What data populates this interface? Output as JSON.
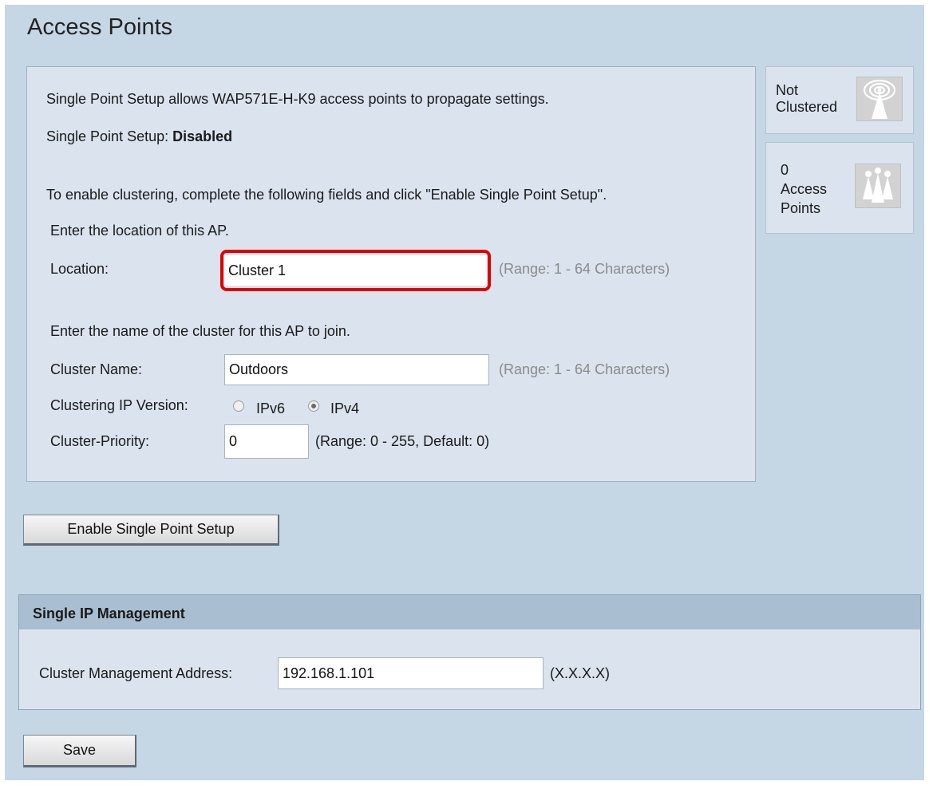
{
  "page": {
    "title": "Access Points"
  },
  "main": {
    "intro": "Single Point Setup allows WAP571E-H-K9 access points to propagate settings.",
    "status_label": "Single Point Setup: ",
    "status_value": "Disabled",
    "instructions": "To enable clustering, complete the following fields and click \"Enable Single Point Setup\".",
    "location_prompt": "Enter the location of this AP.",
    "location": {
      "label": "Location:",
      "value": "Cluster 1",
      "hint": "(Range: 1 - 64 Characters)"
    },
    "cluster_prompt": "Enter the name of the cluster for this AP to join.",
    "cluster_name": {
      "label": "Cluster Name:",
      "value": "Outdoors",
      "hint": "(Range: 1 - 64 Characters)"
    },
    "ip_version": {
      "label": "Clustering IP Version:",
      "options": [
        "IPv6",
        "IPv4"
      ],
      "selected": "IPv4"
    },
    "priority": {
      "label": "Cluster-Priority:",
      "value": "0",
      "hint": "(Range: 0 - 255, Default: 0)"
    }
  },
  "side": {
    "cluster_status": {
      "line1": "Not",
      "line2": "Clustered",
      "icon": "antenna-icon"
    },
    "ap_count": {
      "count": "0",
      "line1": "Access",
      "line2": "Points",
      "icon": "access-points-icon"
    }
  },
  "buttons": {
    "enable": "Enable Single Point Setup",
    "save": "Save"
  },
  "sip": {
    "header": "Single IP Management",
    "address_label": "Cluster Management Address:",
    "address_value": "192.168.1.101",
    "address_hint": "(X.X.X.X)"
  },
  "colors": {
    "background": "#c5d6e5",
    "panel": "#dbe4ee",
    "section_header": "#a9bfd1",
    "highlight": "#e00000"
  }
}
